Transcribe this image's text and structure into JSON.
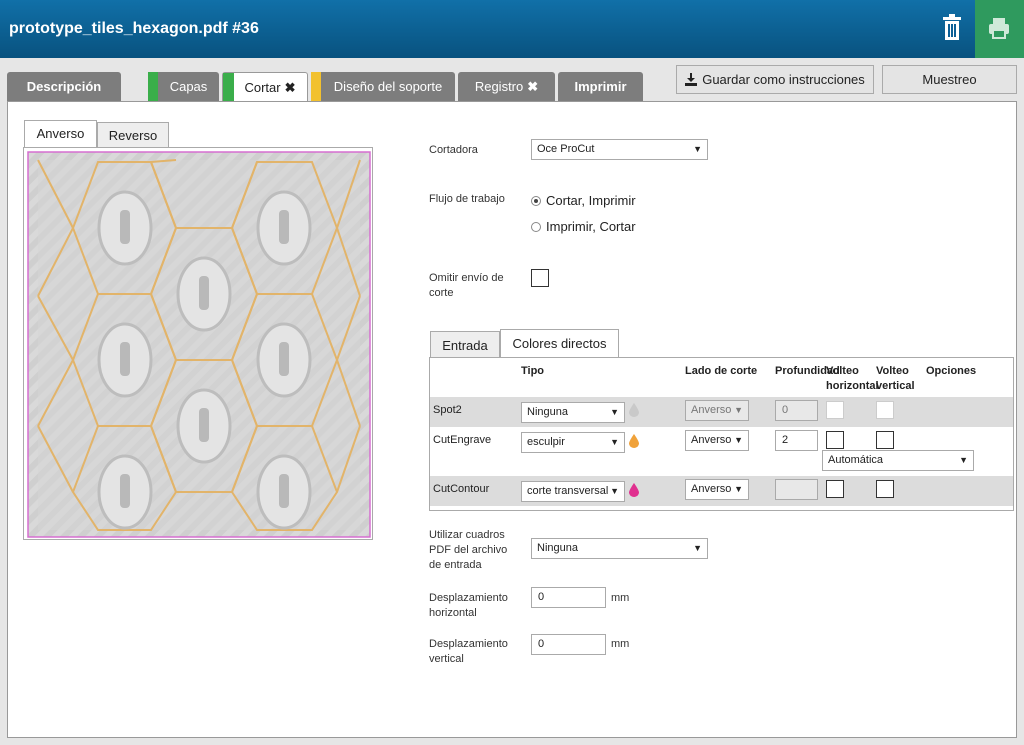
{
  "header": {
    "title": "prototype_tiles_hexagon.pdf #36",
    "trash_icon": "trash-icon",
    "print_icon": "printer-icon"
  },
  "tabs": [
    {
      "label": "Descripción",
      "state": "inactive"
    },
    {
      "label": "Capas",
      "marker": "#3aae4a"
    },
    {
      "label": "Cortar",
      "marker": "#3aae4a",
      "suffix": "✖",
      "state": "active"
    },
    {
      "label": "Diseño del soporte",
      "marker": "#f2c12e"
    },
    {
      "label": "Registro",
      "suffix": "✖"
    },
    {
      "label": "Imprimir"
    }
  ],
  "toolbar": {
    "save_label": "Guardar como instrucciones",
    "sample_label": "Muestreo"
  },
  "preview": {
    "tabs": [
      "Anverso",
      "Reverso"
    ],
    "active": "Anverso"
  },
  "form": {
    "cutter_label": "Cortadora",
    "cutter_value": "Oce ProCut",
    "workflow_label": "Flujo de trabajo",
    "workflow_options": [
      "Cortar, Imprimir",
      "Imprimir, Cortar"
    ],
    "workflow_selected": "Cortar, Imprimir",
    "omit_label_1": "Omitir envío de",
    "omit_label_2": "corte",
    "pdf_boxes_label_1": "Utilizar cuadros",
    "pdf_boxes_label_2": "PDF del archivo",
    "pdf_boxes_label_3": "de entrada",
    "pdf_boxes_value": "Ninguna",
    "hoffset_label_1": "Desplazamiento",
    "hoffset_label_2": "horizontal",
    "hoffset_value": "0",
    "voffset_label_1": "Desplazamiento",
    "voffset_label_2": "vertical",
    "voffset_value": "0",
    "unit": "mm"
  },
  "color_tabs": [
    "Entrada",
    "Colores directos"
  ],
  "color_table": {
    "headers": {
      "type": "Tipo",
      "side": "Lado de corte",
      "depth": "Profundidad",
      "hflip_1": "Volteo",
      "hflip_2": "horizontal",
      "vflip_1": "Volteo",
      "vflip_2": "vertical",
      "options": "Opciones"
    },
    "rows": [
      {
        "name": "Spot2",
        "type": "Ninguna",
        "side": "Anverso",
        "depth": "0",
        "drop_color": "#c9c9c9"
      },
      {
        "name": "CutEngrave",
        "type": "esculpir",
        "side": "Anverso",
        "depth": "2",
        "drop_color": "#f0a23a",
        "option": "Automática"
      },
      {
        "name": "CutContour",
        "type": "corte transversal",
        "side": "Anverso",
        "depth": "",
        "drop_color": "#e0308f"
      }
    ]
  }
}
